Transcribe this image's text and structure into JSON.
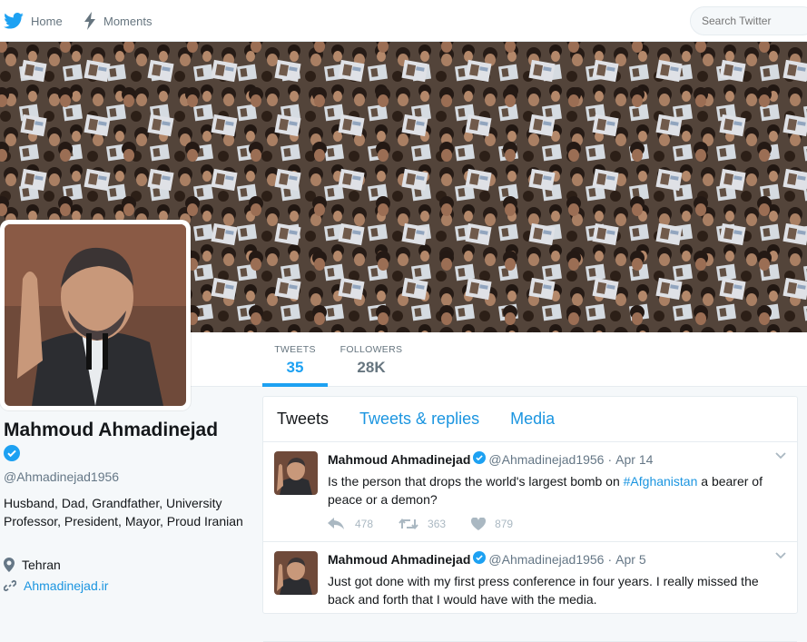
{
  "nav": {
    "home": "Home",
    "moments": "Moments",
    "search_placeholder": "Search Twitter"
  },
  "profile": {
    "name": "Mahmoud Ahmadinejad",
    "handle": "@Ahmadinejad1956",
    "bio": "Husband, Dad, Grandfather, University Professor, President, Mayor, Proud Iranian",
    "location": "Tehran",
    "url": "Ahmadinejad.ir"
  },
  "stats": {
    "tweets_label": "TWEETS",
    "tweets_value": "35",
    "followers_label": "FOLLOWERS",
    "followers_value": "28K"
  },
  "tabs": {
    "tweets": "Tweets",
    "replies": "Tweets & replies",
    "media": "Media"
  },
  "tweets": [
    {
      "name": "Mahmoud Ahmadinejad",
      "handle": "@Ahmadinejad1956",
      "sep": "·",
      "date": "Apr 14",
      "text_before": "Is the person that drops the world's largest bomb on ",
      "hashtag": "#Afghanistan",
      "text_after": " a bearer of peace or a demon?",
      "replies": "478",
      "retweets": "363",
      "likes": "879"
    },
    {
      "name": "Mahmoud Ahmadinejad",
      "handle": "@Ahmadinejad1956",
      "sep": "·",
      "date": "Apr 5",
      "text": "Just got done with my first press conference in four years. I really missed the back and forth that I would have with the media."
    }
  ],
  "colors": {
    "accent": "#1da1f2",
    "link": "#1b95e0",
    "muted": "#657786"
  }
}
